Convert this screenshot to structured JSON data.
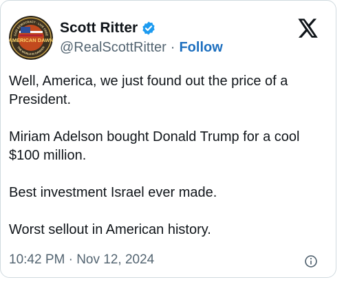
{
  "author": {
    "name": "Scott Ritter",
    "handle": "@RealScottRitter",
    "separator": "·",
    "follow_label": "Follow",
    "avatar_text": {
      "top": "GOD DEMOCRACY · LIVE FREE",
      "center": "AMERICAN DAWN",
      "bottom": "THE WORLD IN DANGER"
    }
  },
  "tweet": {
    "paragraphs": [
      "Well, America, we just found out the price of a President.",
      "Miriam Adelson bought Donald Trump for a cool $100 million.",
      "Best investment Israel ever made.",
      "Worst sellout in American history."
    ],
    "timestamp": "10:42 PM · Nov 12, 2024"
  },
  "icons": {
    "platform_logo": "x-logo-icon",
    "verified": "verified-badge-icon",
    "info": "info-icon"
  },
  "colors": {
    "follow": "#1d6fbf",
    "verified": "#1d9bf0",
    "secondary_text": "#536471",
    "border": "#cfd9de"
  }
}
